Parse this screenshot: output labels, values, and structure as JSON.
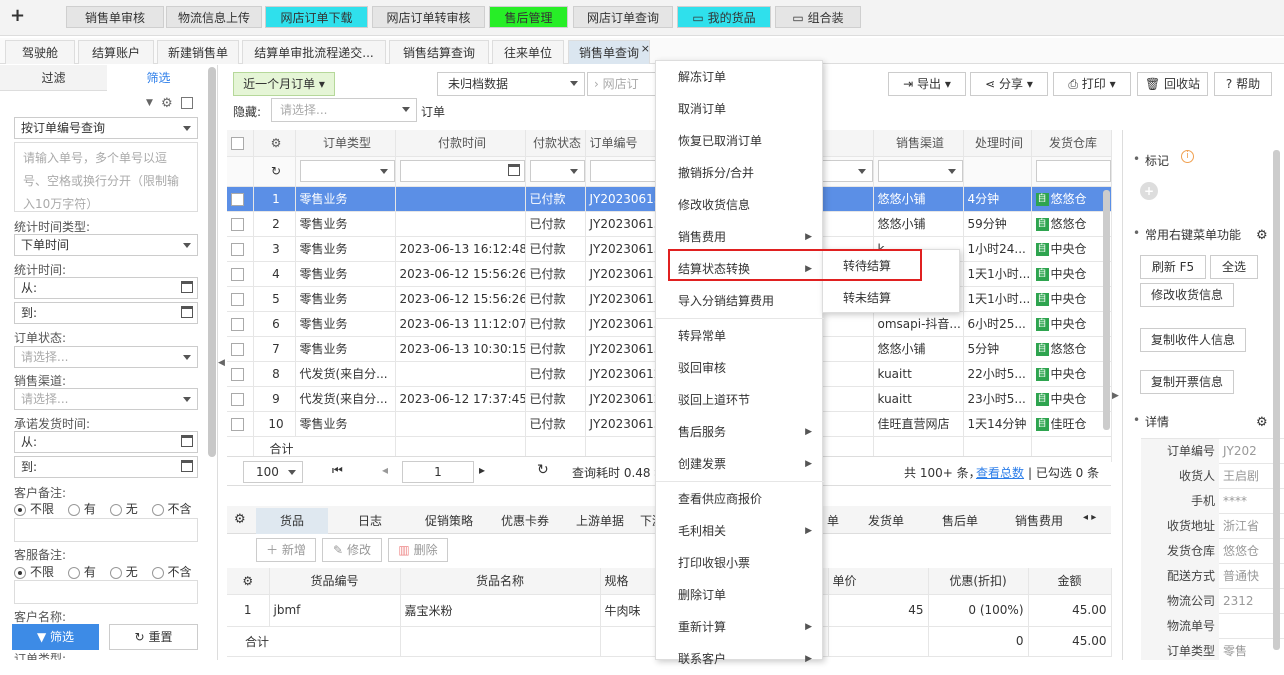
{
  "top_tabs": [
    {
      "label": "销售单审核"
    },
    {
      "label": "物流信息上传"
    },
    {
      "label": "网店订单下载"
    },
    {
      "label": "网店订单转审核"
    },
    {
      "label": "售后管理"
    },
    {
      "label": "网店订单查询"
    },
    {
      "label": "我的货品"
    },
    {
      "label": "组合装"
    }
  ],
  "sub_tabs": [
    {
      "label": "驾驶舱"
    },
    {
      "label": "结算账户"
    },
    {
      "label": "新建销售单"
    },
    {
      "label": "结算单审批流程递交..."
    },
    {
      "label": "销售结算查询"
    },
    {
      "label": "往来单位"
    },
    {
      "label": "销售单查询"
    }
  ],
  "sub_tab_close": "×",
  "left": {
    "tab_filter": "过滤",
    "tab_screen": "筛选",
    "query_mode": "按订单编号查询",
    "order_no_placeholder": "请输入单号，多个单号以逗号、空格或换行分开（限制输入10万字符）",
    "stat_time_type_label": "统计时间类型:",
    "stat_time_type": "下单时间",
    "stat_time_label": "统计时间:",
    "from": "从:",
    "to": "到:",
    "order_status_label": "订单状态:",
    "please_select": "请选择...",
    "channel_label": "销售渠道:",
    "promise_label": "承诺发货时间:",
    "cust_note_label": "客户备注:",
    "svc_note_label": "客服备注:",
    "radio_opts": [
      "不限",
      "有",
      "无",
      "不含"
    ],
    "cust_name_label": "客户名称:",
    "order_type_label": "订单类型:",
    "btn_filter": "筛选",
    "btn_reset": "重置"
  },
  "toolbar": {
    "period": "近一个月订单",
    "archive": "未归档数据",
    "shop_placeholder": "网店订",
    "hidden_label": "隐藏:",
    "hidden_placeholder": "请选择...",
    "order_suffix": "订单",
    "export": "导出",
    "share": "分享",
    "print": "打印",
    "recycle": "回收站",
    "help": "帮助"
  },
  "grid": {
    "headers": [
      "订单类型",
      "付款时间",
      "付款状态",
      "订单编号",
      "销售渠道",
      "处理时间",
      "发货仓库"
    ],
    "rows": [
      {
        "n": "1",
        "type": "零售业务",
        "time": "",
        "status": "已付款",
        "no": "JY20230613",
        "channel": "悠悠小铺",
        "proc": "4分钟",
        "wh": "悠悠仓"
      },
      {
        "n": "2",
        "type": "零售业务",
        "time": "",
        "status": "已付款",
        "no": "JY20230613",
        "channel": "悠悠小铺",
        "proc": "59分钟",
        "wh": "悠悠仓"
      },
      {
        "n": "3",
        "type": "零售业务",
        "time": "2023-06-13 16:12:48",
        "status": "已付款",
        "no": "JY20230613",
        "channel": "k...",
        "proc": "1小时24...",
        "wh": "中央仓"
      },
      {
        "n": "4",
        "type": "零售业务",
        "time": "2023-06-12 15:56:26",
        "status": "已付款",
        "no": "JY20230613",
        "channel": "",
        "proc": "1天1小时...",
        "wh": "中央仓"
      },
      {
        "n": "5",
        "type": "零售业务",
        "time": "2023-06-12 15:56:26",
        "status": "已付款",
        "no": "JY20230613",
        "channel": "",
        "proc": "1天1小时...",
        "wh": "中央仓"
      },
      {
        "n": "6",
        "type": "零售业务",
        "time": "2023-06-13 11:12:07",
        "status": "已付款",
        "no": "JY20230613",
        "channel": "omsapi-抖音...",
        "proc": "6小时25...",
        "wh": "中央仓"
      },
      {
        "n": "7",
        "type": "零售业务",
        "time": "2023-06-13 10:30:15",
        "status": "已付款",
        "no": "JY20230613",
        "channel": "悠悠小铺",
        "proc": "5分钟",
        "wh": "悠悠仓"
      },
      {
        "n": "8",
        "type": "代发货(来自分...",
        "time": "",
        "status": "已付款",
        "no": "JY20230612",
        "channel": "kuaitt",
        "proc": "22小时5...",
        "wh": "中央仓"
      },
      {
        "n": "9",
        "type": "代发货(来自分...",
        "time": "2023-06-12 17:37:45",
        "status": "已付款",
        "no": "JY20230612",
        "channel": "kuaitt",
        "proc": "23小时5...",
        "wh": "中央仓"
      },
      {
        "n": "10",
        "type": "零售业务",
        "time": "",
        "status": "已付款",
        "no": "JY20230613",
        "channel": "佳旺直营网店",
        "proc": "1天14分钟",
        "wh": "佳旺仓"
      }
    ],
    "total_label": "合计",
    "page_size": "100",
    "page": "1",
    "query_time": "查询耗时 0.48 秒",
    "summary": "共 100+ 条，",
    "view_total": "查看总数",
    "selected": "| 已勾选 0 条"
  },
  "context_menu": [
    {
      "label": "解冻订单",
      "sub": false
    },
    {
      "label": "取消订单",
      "sub": false
    },
    {
      "label": "恢复已取消订单",
      "sub": false
    },
    {
      "label": "撤销拆分/合并",
      "sub": false
    },
    {
      "label": "修改收货信息",
      "sub": false
    },
    {
      "label": "销售费用",
      "sub": true
    },
    {
      "label": "结算状态转换",
      "sub": true
    },
    {
      "label": "导入分销结算费用",
      "sub": false
    },
    {
      "label": "转异常单",
      "sub": false
    },
    {
      "label": "驳回审核",
      "sub": false
    },
    {
      "label": "驳回上道环节",
      "sub": false
    },
    {
      "label": "售后服务",
      "sub": true
    },
    {
      "label": "创建发票",
      "sub": true
    },
    {
      "label": "查看供应商报价",
      "sub": false
    },
    {
      "label": "毛利相关",
      "sub": true
    },
    {
      "label": "打印收银小票",
      "sub": false
    },
    {
      "label": "删除订单",
      "sub": false
    },
    {
      "label": "重新计算",
      "sub": true
    },
    {
      "label": "联系客户",
      "sub": true
    }
  ],
  "submenu": [
    {
      "label": "转待结算"
    },
    {
      "label": "转未结算"
    }
  ],
  "right": {
    "mark_label": "标记",
    "common_label": "常用右键菜单功能",
    "btn_refresh": "刷新 F5",
    "btn_select_all": "全选",
    "btn_modify": "修改收货信息",
    "btn_copy_recv": "复制收件人信息",
    "btn_copy_inv": "复制开票信息",
    "detail_label": "详情",
    "details": [
      {
        "k": "订单编号",
        "v": "JY202"
      },
      {
        "k": "收货人",
        "v": "王启剧"
      },
      {
        "k": "手机",
        "v": "****"
      },
      {
        "k": "收货地址",
        "v": "浙江省"
      },
      {
        "k": "发货仓库",
        "v": "悠悠仓"
      },
      {
        "k": "配送方式",
        "v": "普通快"
      },
      {
        "k": "物流公司",
        "v": "2312"
      },
      {
        "k": "物流单号",
        "v": ""
      },
      {
        "k": "订单类型",
        "v": "零售"
      }
    ]
  },
  "lower": {
    "tabs": [
      "货品",
      "日志",
      "促销策略",
      "优惠卡券",
      "上游单据",
      "下游",
      "单",
      "发货单",
      "售后单",
      "销售费用"
    ],
    "btn_add": "新增",
    "btn_edit": "修改",
    "btn_delete": "删除",
    "headers": [
      "货品编号",
      "货品名称",
      "规格",
      "单价",
      "优惠(折扣)",
      "金额"
    ],
    "row": {
      "n": "1",
      "code": "jbmf",
      "name": "嘉宝米粉",
      "spec": "牛肉味",
      "price": "45",
      "disc": "0 (100%)",
      "amount": "45.00"
    },
    "total_label": "合计",
    "total_disc": "0",
    "total_amount": "45.00"
  }
}
